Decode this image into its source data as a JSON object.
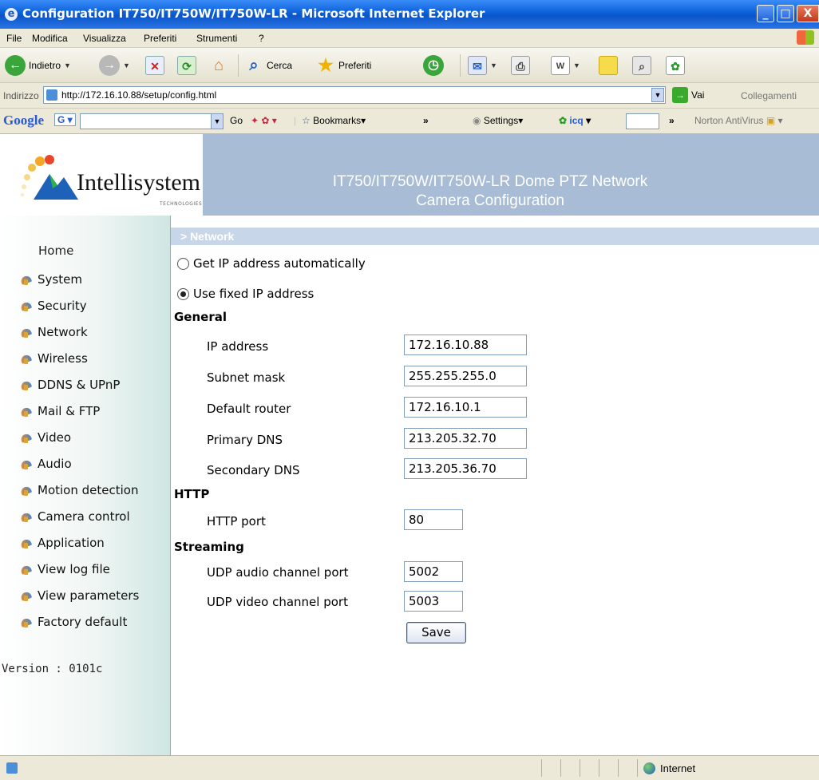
{
  "window": {
    "title": "Configuration IT750/IT750W/IT750W-LR - Microsoft Internet Explorer",
    "minimize": "_",
    "maximize": "□",
    "close": "X"
  },
  "menu": [
    "File",
    "Modifica",
    "Visualizza",
    "Preferiti",
    "Strumenti",
    "?"
  ],
  "toolbar": {
    "back": "Indietro",
    "search": "Cerca",
    "favorites": "Preferiti"
  },
  "address": {
    "label": "Indirizzo",
    "url": "http://172.16.10.88/setup/config.html",
    "go": "Vai",
    "links": "Collegamenti"
  },
  "google_bar": {
    "logo": "Google",
    "g_label": "G",
    "go": "Go",
    "bookmarks": "Bookmarks",
    "settings": "Settings",
    "icq": "icq",
    "norton": "Norton AntiVirus",
    "chevron": "»"
  },
  "header": {
    "logo_text": "Intellisystem",
    "logo_subtext": "TECHNOLOGIES",
    "title_line1": "IT750/IT750W/IT750W-LR Dome PTZ Network",
    "title_line2": "Camera Configuration"
  },
  "nav": {
    "home": "Home",
    "items": [
      "System",
      "Security",
      "Network",
      "Wireless",
      "DDNS & UPnP",
      "Mail & FTP",
      "Video",
      "Audio",
      "Motion detection",
      "Camera control",
      "Application",
      "View log file",
      "View parameters",
      "Factory default"
    ],
    "version": "Version : 0101c"
  },
  "section": {
    "title": "> Network"
  },
  "ip_mode": {
    "auto_label": "Get IP address automatically",
    "fixed_label": "Use fixed IP address",
    "selected": "fixed"
  },
  "general": {
    "heading": "General",
    "ip_label": "IP address",
    "ip_value": "172.16.10.88",
    "subnet_label": "Subnet mask",
    "subnet_value": "255.255.255.0",
    "router_label": "Default router",
    "router_value": "172.16.10.1",
    "dns1_label": "Primary DNS",
    "dns1_value": "213.205.32.70",
    "dns2_label": "Secondary DNS",
    "dns2_value": "213.205.36.70"
  },
  "http": {
    "heading": "HTTP",
    "port_label": "HTTP port",
    "port_value": "80"
  },
  "streaming": {
    "heading": "Streaming",
    "audio_label": "UDP audio channel port",
    "audio_value": "5002",
    "video_label": "UDP video channel port",
    "video_value": "5003"
  },
  "save_label": "Save",
  "status": {
    "zone": "Internet"
  }
}
